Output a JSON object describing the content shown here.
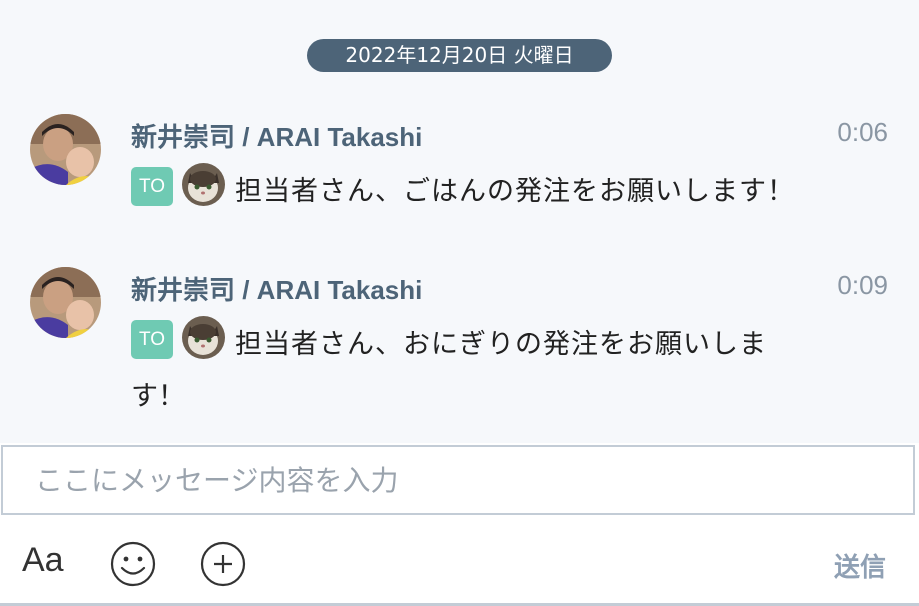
{
  "date_divider": "2022年12月20日 火曜日",
  "messages": [
    {
      "sender": "新井崇司 / ARAI Takashi",
      "time": "0:06",
      "to_label": "TO",
      "text": "担当者さん、ごはんの発注をお願いします！",
      "text_wrap": ""
    },
    {
      "sender": "新井崇司 / ARAI Takashi",
      "time": "0:09",
      "to_label": "TO",
      "text": "担当者さん、おにぎりの発注をお願いしま",
      "text_wrap": "す！"
    }
  ],
  "composer": {
    "placeholder": "ここにメッセージ内容を入力",
    "value": "",
    "font_button": "Aa",
    "emoji_icon": "smiley-icon",
    "attach_icon": "plus-circle-icon",
    "send_label": "送信"
  },
  "colors": {
    "date_pill": "#4d6478",
    "sender": "#4d6478",
    "to_badge": "#6fcab3",
    "send": "#8fa0b4"
  }
}
